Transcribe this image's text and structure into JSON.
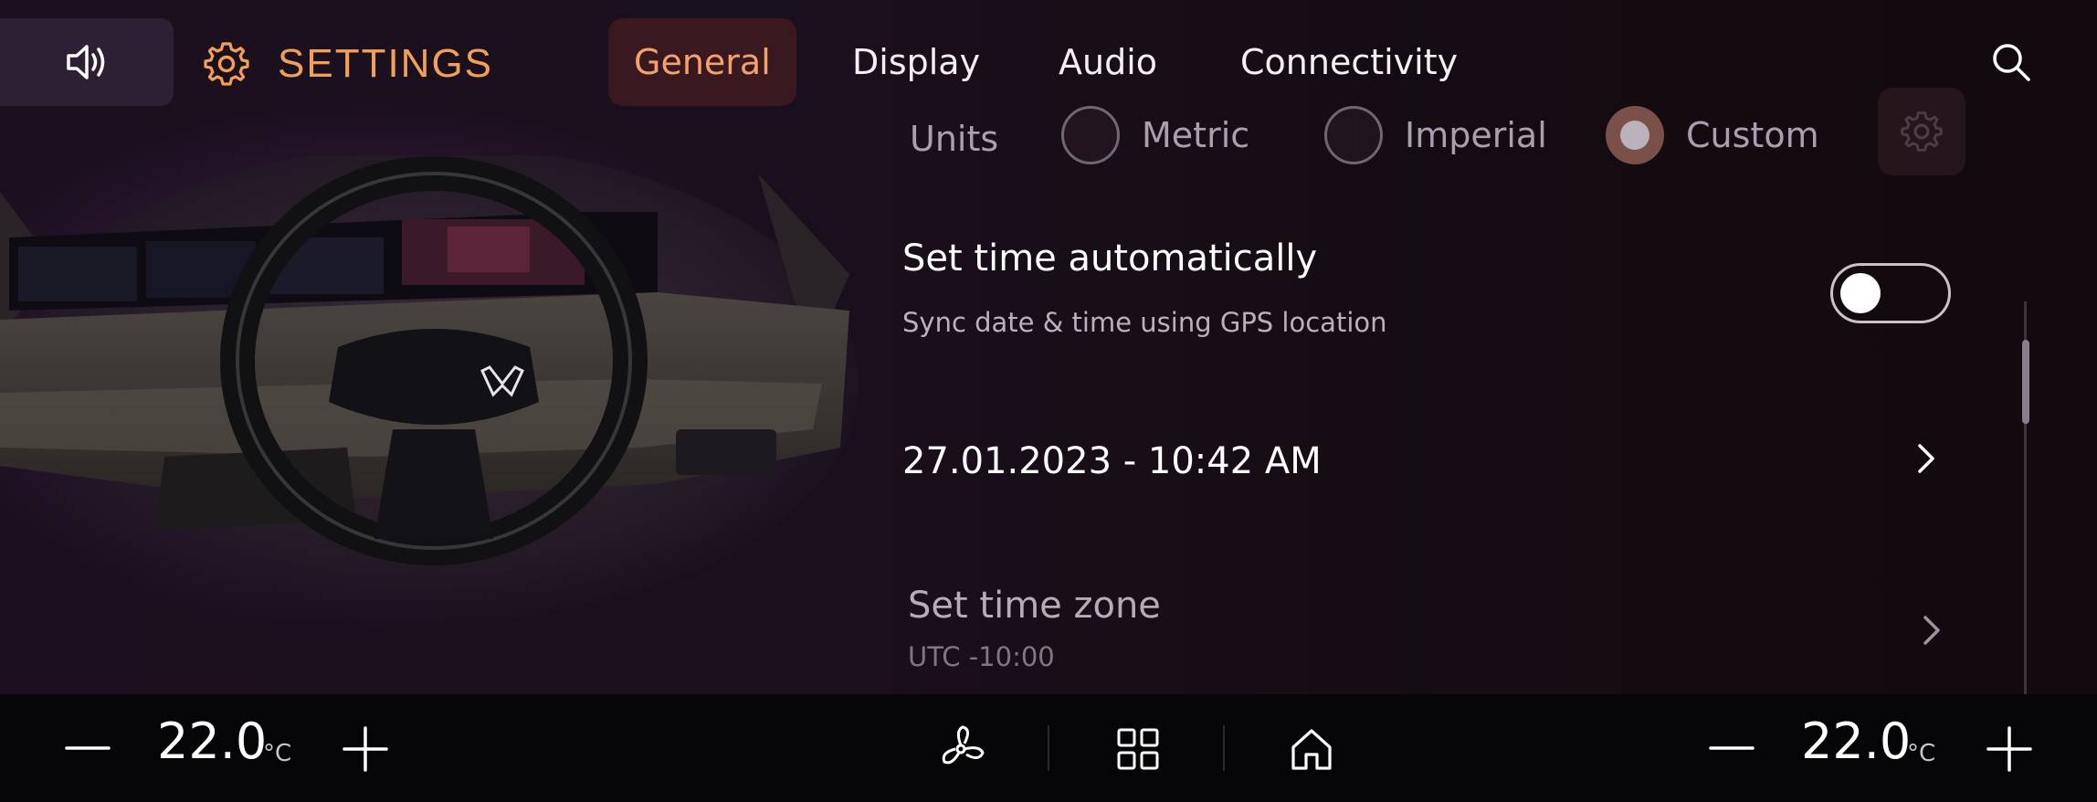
{
  "header": {
    "title": "SETTINGS",
    "tabs": [
      {
        "label": "General",
        "active": true
      },
      {
        "label": "Display",
        "active": false
      },
      {
        "label": "Audio",
        "active": false
      },
      {
        "label": "Connectivity",
        "active": false
      }
    ],
    "icons": {
      "volume": "volume-icon",
      "settings": "gear-icon",
      "search": "search-icon"
    }
  },
  "units": {
    "label": "Units",
    "options": [
      {
        "label": "Metric",
        "selected": false
      },
      {
        "label": "Imperial",
        "selected": false
      },
      {
        "label": "Custom",
        "selected": true
      }
    ],
    "custom_settings_icon": "gear-icon"
  },
  "time": {
    "auto_title": "Set time automatically",
    "auto_subtitle": "Sync date & time using GPS location",
    "auto_enabled": false,
    "datetime": "27.01.2023 - 10:42 AM",
    "timezone_title": "Set time zone",
    "timezone_value": "UTC -10:00"
  },
  "climate": {
    "left_temp": "22.0",
    "right_temp": "22.0",
    "unit": "°C",
    "icons": [
      "minus-icon",
      "plus-icon",
      "fan-icon",
      "apps-grid-icon",
      "home-icon"
    ]
  },
  "colors": {
    "accent": "#f2a058",
    "tab_active_bg": "#461c20",
    "background": "#1a0f1c"
  }
}
